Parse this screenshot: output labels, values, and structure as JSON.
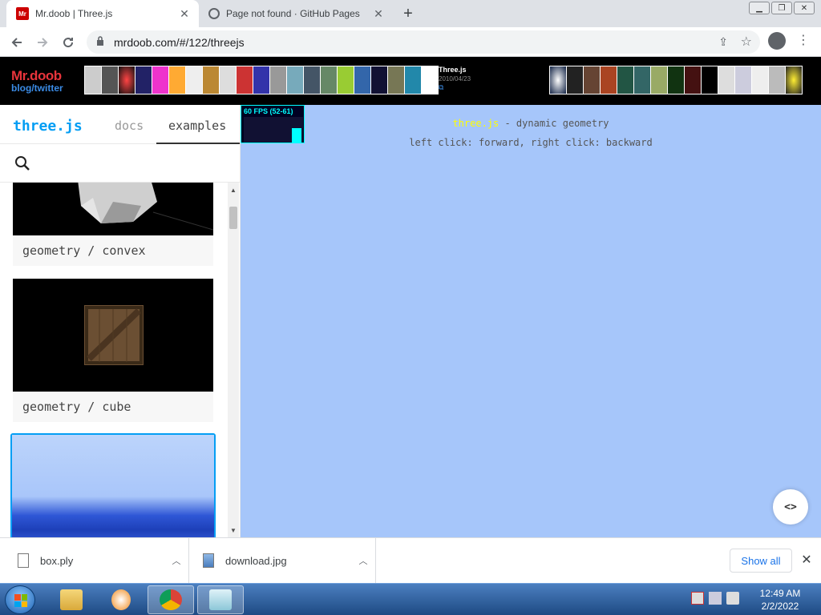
{
  "browser": {
    "tabs": [
      {
        "title": "Mr.doob | Three.js",
        "favicon": "Mr",
        "active": true
      },
      {
        "title": "Page not found · GitHub Pages",
        "active": false
      }
    ],
    "close_glyph": "✕",
    "new_tab_glyph": "+",
    "window_buttons": [
      "▁",
      "❐",
      "✕"
    ],
    "url": "mrdoob.com/#/122/threejs",
    "icons": {
      "back": "arrow-left-icon",
      "forward": "arrow-right-icon",
      "reload": "reload-icon",
      "share": "share-icon",
      "star": "star-icon"
    }
  },
  "banner": {
    "brand_name": "Mr.doob",
    "brand_sub": "blog/twitter",
    "current_project": {
      "title": "Three.js",
      "date": "2010/04/23",
      "link_glyph": "⧉"
    }
  },
  "sidebar": {
    "logo": "three.js",
    "nav": {
      "docs": "docs",
      "examples": "examples"
    },
    "search_placeholder": "",
    "cards": [
      {
        "label": "geometry / convex"
      },
      {
        "label": "geometry / cube"
      },
      {
        "label": ""
      }
    ]
  },
  "viewport": {
    "fps_text": "60 FPS (52-61)",
    "info_link": "three.js",
    "info_rest": " - dynamic geometry",
    "info_line2": "left click: forward, right click: backward",
    "code_button": "<>",
    "background": "#a6c6fa"
  },
  "downloads": {
    "items": [
      {
        "name": "box.ply"
      },
      {
        "name": "download.jpg"
      }
    ],
    "show_all": "Show all",
    "close_glyph": "✕"
  },
  "taskbar": {
    "time": "12:49 AM",
    "date": "2/2/2022"
  }
}
